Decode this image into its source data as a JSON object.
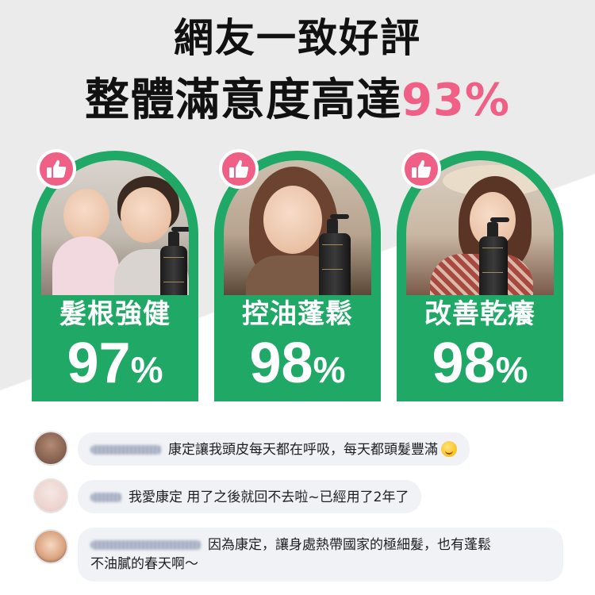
{
  "headline": {
    "line1": "網友一致好評",
    "line2_main": "整體滿意度高達",
    "line2_percent": "93%"
  },
  "colors": {
    "card_green": "#1fa866",
    "accent_pink": "#ef5f86"
  },
  "stats": [
    {
      "label": "髮根強健",
      "number": "97",
      "unit": "%"
    },
    {
      "label": "控油蓬鬆",
      "number": "98",
      "unit": "%"
    },
    {
      "label": "改善乾癢",
      "number": "98",
      "unit": "%"
    }
  ],
  "like_icon": "thumbs-up-icon",
  "comments": [
    {
      "text": "康定讓我頭皮每天都在呼吸，每天都頭髮豐滿",
      "emoji": "smiling-face-emoji"
    },
    {
      "text": "我愛康定 用了之後就回不去啦~已經用了2年了"
    },
    {
      "text_line1": "因為康定，讓身處熱帶國家的極細髮，也有蓬鬆",
      "text_line2": "不油膩的春天啊～"
    }
  ]
}
